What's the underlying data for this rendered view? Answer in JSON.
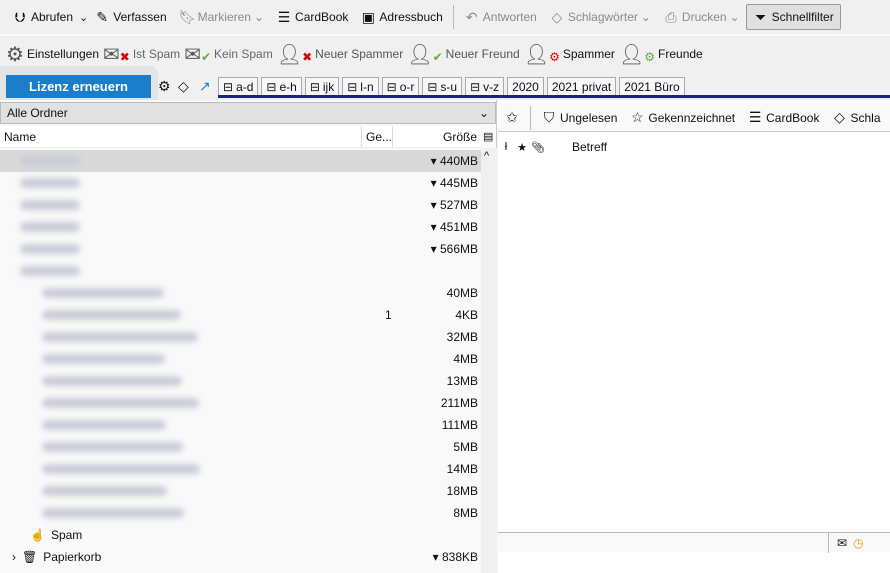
{
  "toolbar": {
    "get": "Abrufen",
    "compose": "Verfassen",
    "mark": "Markieren",
    "cardbook": "CardBook",
    "addressbook": "Adressbuch",
    "reply": "Antworten",
    "tags": "Schlagwörter",
    "print": "Drucken",
    "quickfilter": "Schnellfilter"
  },
  "toolbar2": {
    "settings": "Einstellungen",
    "is_spam": "Ist Spam",
    "not_spam": "Kein Spam",
    "new_spammer": "Neuer Spammer",
    "new_friend": "Neuer Freund",
    "spammer": "Spammer",
    "friends": "Freunde"
  },
  "license": "Lizenz erneuern",
  "tag_buttons": [
    "a-d",
    "e-h",
    "ijk",
    "l-n",
    "o-r",
    "s-u",
    "v-z",
    "2020",
    "2021 privat",
    "2021 Büro"
  ],
  "folder_pane": {
    "selector": "Alle Ordner",
    "col_name": "Name",
    "col_count": "Ge...",
    "col_size": "Größe",
    "rows": [
      {
        "size": "▾ 440MB",
        "count": "",
        "level": 0
      },
      {
        "size": "▾ 445MB",
        "count": "",
        "level": 0
      },
      {
        "size": "▾ 527MB",
        "count": "",
        "level": 0
      },
      {
        "size": "▾ 451MB",
        "count": "",
        "level": 0
      },
      {
        "size": "▾ 566MB",
        "count": "",
        "level": 0
      },
      {
        "size": "",
        "count": "",
        "level": 0
      },
      {
        "size": "40MB",
        "count": "",
        "level": 1
      },
      {
        "size": "4KB",
        "count": "1",
        "level": 1
      },
      {
        "size": "32MB",
        "count": "",
        "level": 1
      },
      {
        "size": "4MB",
        "count": "",
        "level": 1
      },
      {
        "size": "13MB",
        "count": "",
        "level": 1
      },
      {
        "size": "211MB",
        "count": "",
        "level": 1
      },
      {
        "size": "111MB",
        "count": "",
        "level": 1
      },
      {
        "size": "5MB",
        "count": "",
        "level": 1
      },
      {
        "size": "14MB",
        "count": "",
        "level": 1
      },
      {
        "size": "18MB",
        "count": "",
        "level": 1
      },
      {
        "size": "8MB",
        "count": "",
        "level": 1
      }
    ],
    "spam": "Spam",
    "trash": "Papierkorb",
    "trash_size": "▾ 838KB"
  },
  "quickfilter": {
    "unread": "Ungelesen",
    "flagged": "Gekennzeichnet",
    "cardbook": "CardBook",
    "tags": "Schla"
  },
  "message_list": {
    "subject": "Betreff"
  }
}
